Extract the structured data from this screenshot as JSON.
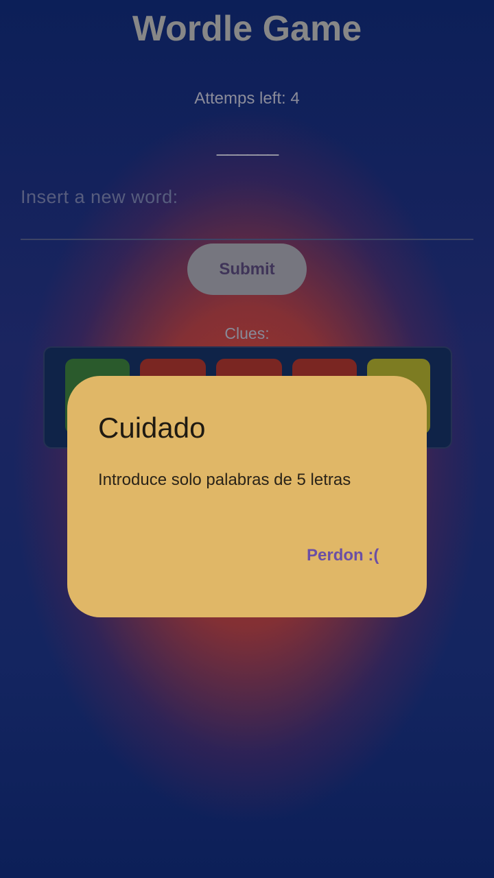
{
  "app": {
    "title": "Wordle Game",
    "attempts_text": "Attemps left: 4",
    "word_blanks": "______"
  },
  "input": {
    "placeholder": "Insert a new word:",
    "value": ""
  },
  "submit": {
    "label": "Submit"
  },
  "clues": {
    "label": "Clues:",
    "tiles": [
      {
        "color": "#2a5a2c"
      },
      {
        "color": "#7a2622"
      },
      {
        "color": "#7a2622"
      },
      {
        "color": "#7a2622"
      },
      {
        "color": "#7d7c22"
      }
    ]
  },
  "dialog": {
    "title": "Cuidado",
    "message": "Introduce solo palabras de 5 letras",
    "action_label": "Perdon :("
  },
  "colors": {
    "dialog_background": "#e0b767",
    "action_text": "#6b4fa5",
    "scrim": "#0d1e54"
  }
}
